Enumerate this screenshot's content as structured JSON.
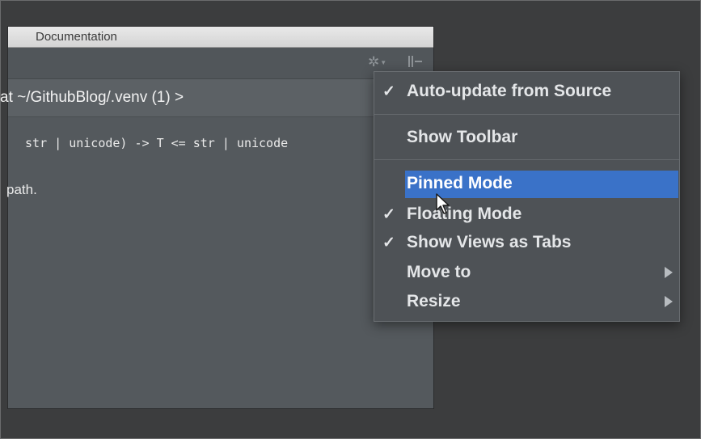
{
  "window": {
    "title": "Documentation",
    "path": "at ~/GithubBlog/.venv (1) >",
    "signature": " str | unicode) -> T <= str | unicode",
    "description": "path."
  },
  "toolbar": {
    "gear_icon": "gear-icon",
    "pin_icon": "pin-icon"
  },
  "menu": {
    "items": [
      {
        "label": "Auto-update from Source",
        "checked": true,
        "submenu": false
      },
      {
        "label": "Show Toolbar",
        "checked": false,
        "submenu": false
      },
      {
        "label": "Pinned Mode",
        "checked": false,
        "submenu": false,
        "selected": true
      },
      {
        "label": "Floating Mode",
        "checked": true,
        "submenu": false
      },
      {
        "label": "Show Views as Tabs",
        "checked": true,
        "submenu": false
      },
      {
        "label": "Move to",
        "checked": false,
        "submenu": true
      },
      {
        "label": "Resize",
        "checked": false,
        "submenu": true
      }
    ],
    "check_glyph": "✓",
    "selection_color": "#3a72c8"
  }
}
